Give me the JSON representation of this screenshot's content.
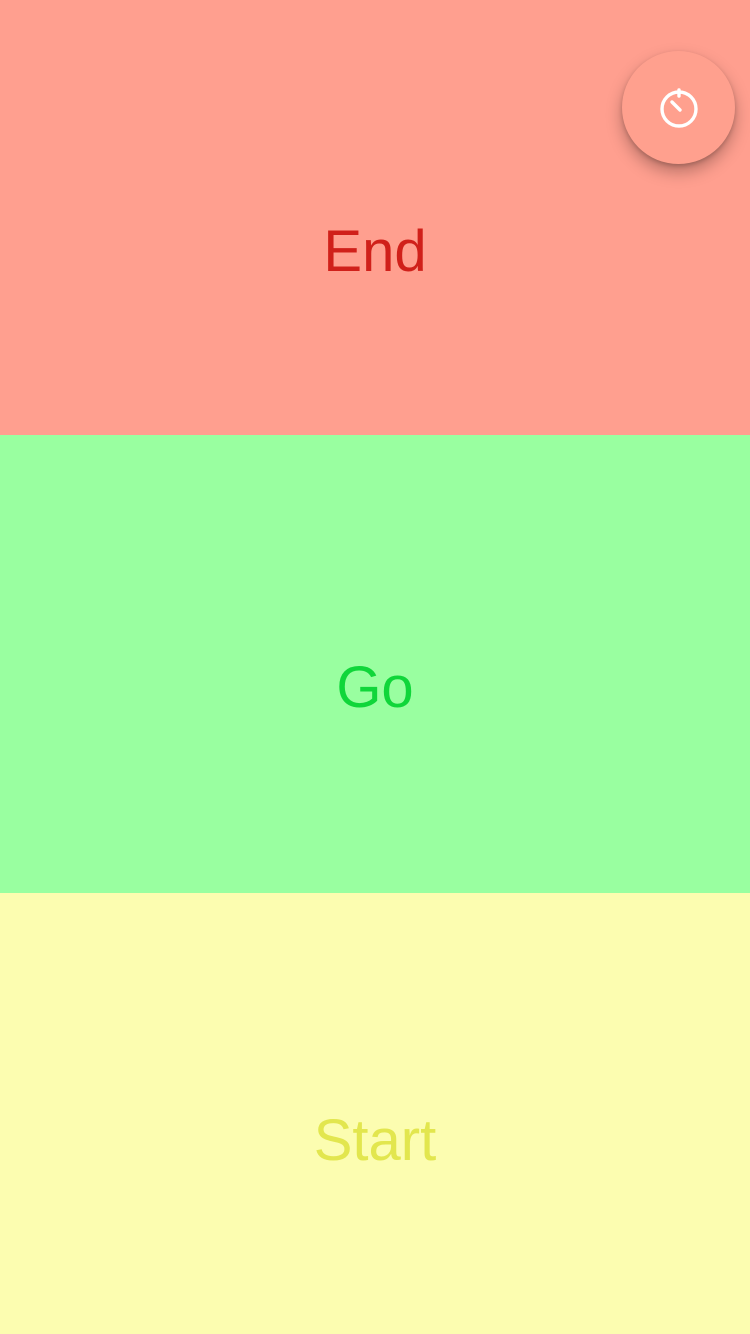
{
  "panels": {
    "end": {
      "label": "End",
      "background": "#FF9F8F",
      "text_color": "#D0201A"
    },
    "go": {
      "label": "Go",
      "background": "#99FFA0",
      "text_color": "#10D63A"
    },
    "start": {
      "label": "Start",
      "background": "#FCFDB0",
      "text_color": "#E2E64E"
    }
  },
  "fab": {
    "icon": "timer-icon",
    "background": "#FFA08E",
    "icon_color": "#FFFFFF"
  }
}
